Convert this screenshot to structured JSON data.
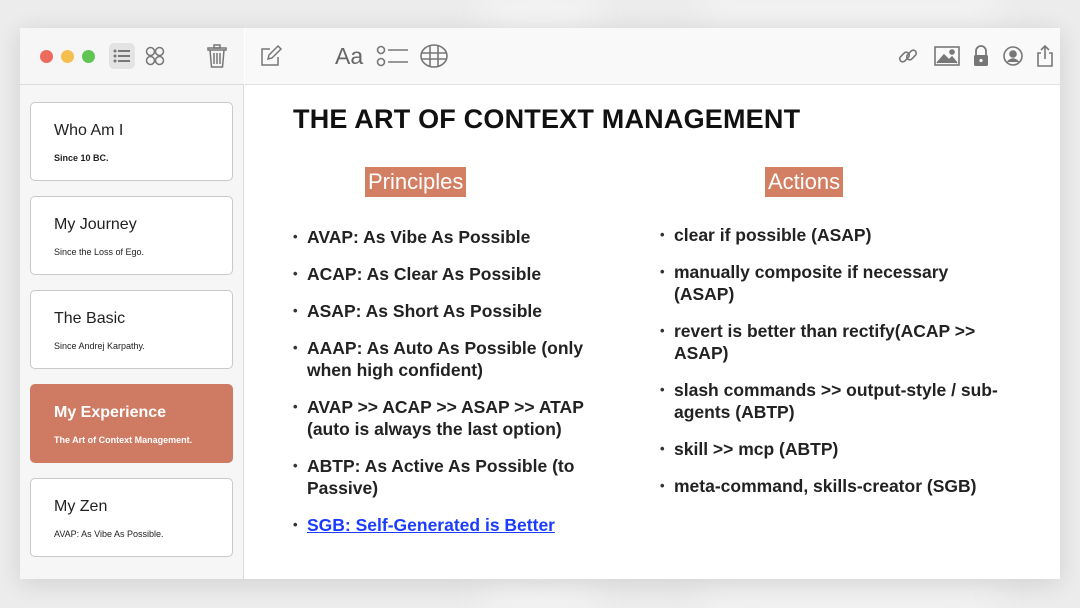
{
  "toolbar": {
    "font_button_label": "Aa"
  },
  "sidebar": {
    "notes": [
      {
        "title": "Who Am I",
        "subtitle": "Since 10 BC."
      },
      {
        "title": "My Journey",
        "subtitle": "Since the Loss of Ego."
      },
      {
        "title": "The Basic",
        "subtitle": "Since Andrej Karpathy."
      },
      {
        "title": "My Experience",
        "subtitle": "The Art of Context Management."
      },
      {
        "title": "My Zen",
        "subtitle": "AVAP: As Vibe As Possible."
      }
    ],
    "selected_index": 3
  },
  "document": {
    "title": "THE ART OF CONTEXT MANAGEMENT",
    "principles": {
      "heading": "Principles",
      "items": [
        "AVAP: As Vibe As Possible",
        "ACAP: As Clear As Possible",
        "ASAP: As Short As Possible",
        "AAAP: As Auto As Possible (only when high confident)",
        "AVAP >> ACAP >> ASAP >> ATAP (auto is always the last option)",
        "ABTP: As Active As Possible (to Passive)",
        "SGB: Self-Generated is Better"
      ]
    },
    "actions": {
      "heading": "Actions",
      "items": [
        "clear if possible (ASAP)",
        "manually composite if necessary (ASAP)",
        "revert is better than rectify(ACAP >> ASAP)",
        "slash commands >> output-style / sub-agents (ABTP)",
        "skill >> mcp (ABTP)",
        "meta-command, skills-creator (SGB)"
      ]
    }
  },
  "colors": {
    "accent": "#cf7b63",
    "link": "#1a3cff"
  },
  "icons": [
    "close-window-icon",
    "minimize-window-icon",
    "zoom-window-icon",
    "list-view-icon",
    "gallery-view-icon",
    "trash-icon",
    "compose-icon",
    "checklist-icon",
    "table-icon",
    "link-icon",
    "image-icon",
    "lock-icon",
    "collaborate-icon",
    "share-icon"
  ]
}
